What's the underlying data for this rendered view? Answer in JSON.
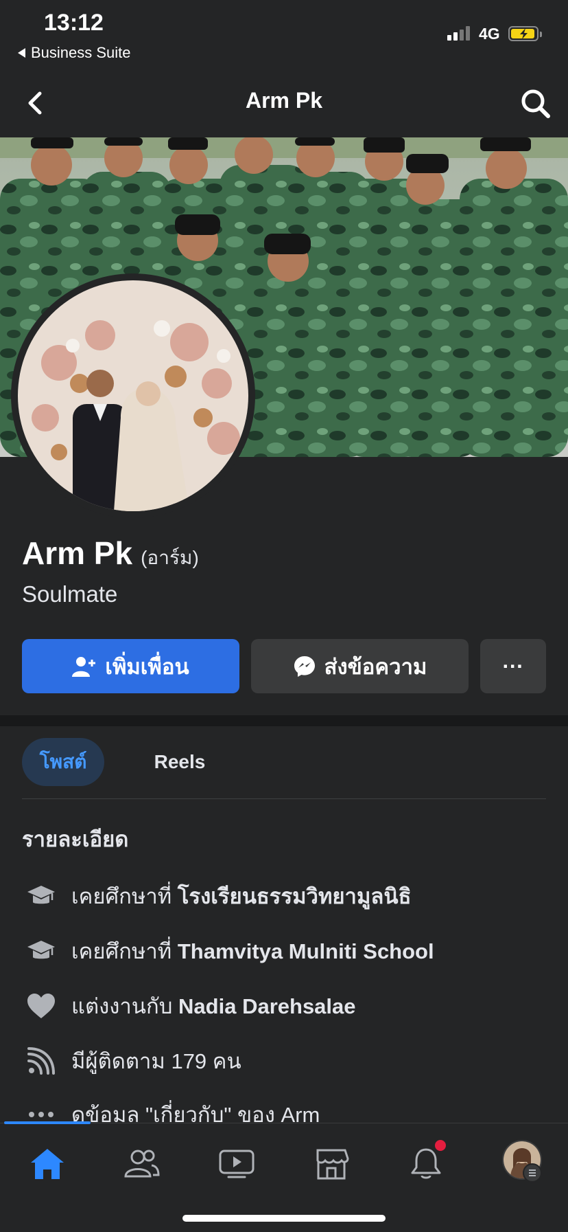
{
  "status_bar": {
    "time": "13:12",
    "back_app": "Business Suite",
    "network": "4G"
  },
  "header": {
    "title": "Arm Pk"
  },
  "profile": {
    "name": "Arm Pk",
    "alternate_name": "(อาร์ม)",
    "bio": "Soulmate"
  },
  "actions": {
    "add_friend": "เพิ่มเพื่อน",
    "message": "ส่งข้อความ",
    "more": "···"
  },
  "tabs": [
    {
      "label": "โพสต์",
      "selected": true
    },
    {
      "label": "Reels",
      "selected": false
    }
  ],
  "details": {
    "title": "รายละเอียด",
    "items": [
      {
        "icon": "graduation-cap-icon",
        "prefix": "เคยศึกษาที่ ",
        "value": "โรงเรียนธรรมวิทยามูลนิธิ"
      },
      {
        "icon": "graduation-cap-icon",
        "prefix": "เคยศึกษาที่ ",
        "value": "Thamvitya Mulniti School"
      },
      {
        "icon": "heart-icon",
        "prefix": "แต่งงานกับ ",
        "value": "Nadia Darehsalae"
      },
      {
        "icon": "rss-icon",
        "prefix": "มีผู้ติดตาม 179 คน",
        "value": ""
      },
      {
        "icon": "more-dots-icon",
        "prefix": "ดข้อมล \"เกี่ยวกับ\" ของ Arm",
        "value": ""
      }
    ]
  },
  "tabbar": {
    "items": [
      "home-icon",
      "friends-icon",
      "watch-icon",
      "marketplace-icon",
      "notifications-icon",
      "profile-menu-avatar"
    ],
    "active": "home-icon"
  },
  "colors": {
    "accent": "#2d6ee3",
    "background": "#242526",
    "tab_selected_bg": "#263951",
    "tab_selected_text": "#4599ff",
    "notification": "#e41e3f"
  }
}
